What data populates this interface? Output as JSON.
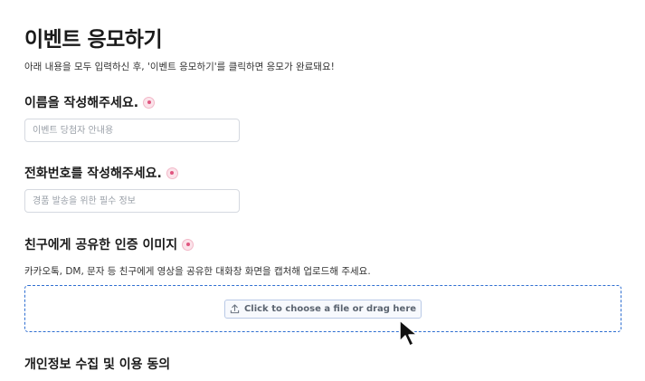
{
  "page": {
    "title": "이벤트 응모하기",
    "description": "아래 내용을 모두 입력하신 후, '이벤트 응모하기'를 클릭하면 응모가 완료돼요!"
  },
  "fields": {
    "name": {
      "label": "이름을 작성해주세요.",
      "placeholder": "이벤트 당첨자 안내용",
      "value": ""
    },
    "phone": {
      "label": "전화번호를 작성해주세요.",
      "placeholder": "경품 발송을 위한 필수 정보",
      "value": ""
    },
    "image": {
      "label": "친구에게 공유한 인증 이미지",
      "hint": "카카오톡, DM, 문자 등 친구에게 영상을 공유한 대화창 화면을 캡처해 업로드해 주세요.",
      "upload_label": "Click to choose a file or drag here",
      "upload_icon": "upload-icon"
    }
  },
  "sections": {
    "privacy_title": "개인정보 수집 및 이용 동의"
  },
  "colors": {
    "required_dot": "#e0557f",
    "dropzone_border": "#2f6fd1"
  }
}
